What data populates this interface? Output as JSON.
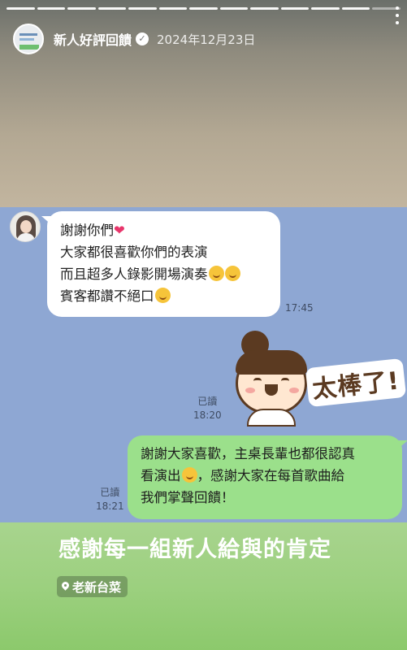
{
  "story": {
    "segments_total": 13,
    "current_segment": 12,
    "account_name": "新人好評回饋",
    "verified": true,
    "post_date": "2024年12月23日"
  },
  "chat": {
    "incoming": {
      "lines": [
        "謝謝你們",
        "大家都很喜歡你們的表演",
        "而且超多人錄影開場演奏",
        "賓客都讚不絕口"
      ],
      "time": "17:45"
    },
    "sticker": {
      "text": "太棒了!",
      "read_label": "已讀",
      "time": "18:20"
    },
    "outgoing": {
      "lines": [
        "謝謝大家喜歡，主桌長輩也都很認真",
        "看演出",
        "，感謝大家在每首歌曲給",
        "我們掌聲回饋！"
      ],
      "read_label": "已讀",
      "time": "18:21"
    }
  },
  "caption": "感謝每一組新人給與的肯定",
  "location": "老新台菜",
  "colors": {
    "chat_background": "#8ea7d3",
    "incoming_bubble": "#ffffff",
    "outgoing_bubble": "#9be08b",
    "bottom_background": "#9cd07f"
  }
}
